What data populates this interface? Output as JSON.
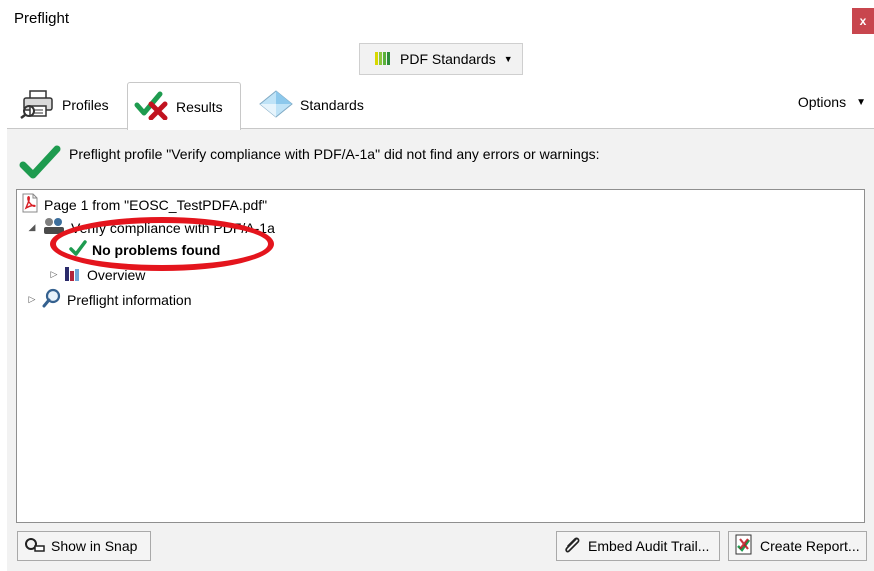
{
  "window": {
    "title": "Preflight",
    "close_label": "x"
  },
  "standards_button": {
    "label": "PDF Standards",
    "icon": "pdf-standards-icon"
  },
  "tabs": [
    {
      "label": "Profiles",
      "icon": "profiles-icon"
    },
    {
      "label": "Results",
      "icon": "results-icon",
      "active": true
    },
    {
      "label": "Standards",
      "icon": "standards-icon"
    }
  ],
  "options": {
    "label": "Options"
  },
  "summary": {
    "message": "Preflight profile \"Verify compliance with PDF/A-1a\" did not find any errors or warnings:"
  },
  "tree": {
    "page": "Page 1 from \"EOSC_TestPDFA.pdf\"",
    "profile": "Verify compliance with PDF/A-1a",
    "result": "No problems found",
    "overview": "Overview",
    "info": "Preflight information"
  },
  "buttons": {
    "show_in_snap": "Show in Snap",
    "embed_audit_trail": "Embed Audit Trail...",
    "create_report": "Create Report..."
  },
  "colors": {
    "accent_green": "#1e9b4f",
    "highlight_red": "#e4151d",
    "close_red": "#c8464e"
  }
}
